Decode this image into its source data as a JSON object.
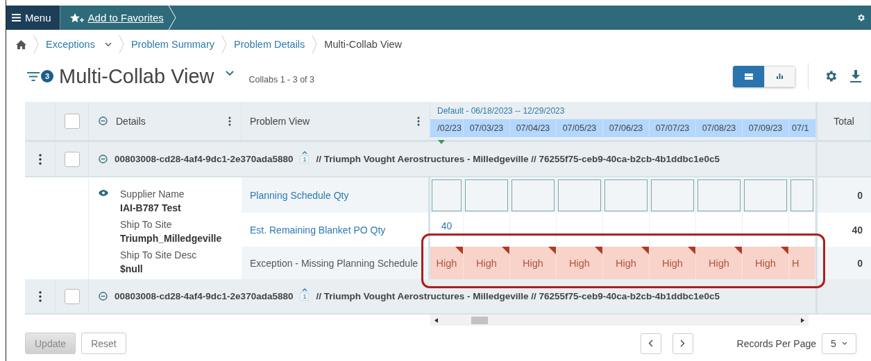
{
  "topbar": {
    "menu": "Menu",
    "favorites": "Add to Favorites"
  },
  "breadcrumbs": [
    {
      "label": "Exceptions",
      "dropdown": true
    },
    {
      "label": "Problem Summary",
      "dropdown": false
    },
    {
      "label": "Problem Details",
      "dropdown": false
    }
  ],
  "breadcrumb_current": "Multi-Collab View",
  "filter_count": "3",
  "title": "Multi-Collab View",
  "collabs": "Collabs 1 - 3 of 3",
  "views": [
    {
      "kind": "table",
      "selected": true
    },
    {
      "kind": "chart",
      "selected": false
    }
  ],
  "table": {
    "header_checked": false,
    "details_label": "Details",
    "problem_label": "Problem View",
    "range": "Default - 06/18/2023 -- 12/29/2023",
    "dates": [
      "/02/23",
      "07/03/23",
      "07/04/23",
      "07/05/23",
      "07/06/23",
      "07/07/23",
      "07/08/23",
      "07/09/23",
      "07/1"
    ],
    "total_label": "Total",
    "groups": [
      {
        "checked": false,
        "expanded": true,
        "id": "00803008-cd28-4af4-9dc1-2e370ada5880",
        "count": "1",
        "description": "// Triumph Vought Aerostructures - Milledgeville // 76255f75-ceb9-40ca-b2cb-4b1ddbc1e0c5",
        "details": [
          {
            "label": "Supplier Name",
            "value": "IAI-B787 Test"
          },
          {
            "label": "Ship To Site",
            "value": "Triumph_Milledgeville"
          },
          {
            "label": "Ship To Site Desc",
            "value": "$null"
          }
        ],
        "rows": [
          {
            "label": "Planning Schedule Qty",
            "link": true,
            "kind": "input",
            "total": "0"
          },
          {
            "label": "Est. Remaining Blanket PO Qty",
            "link": true,
            "kind": "value",
            "values": [
              "40"
            ],
            "total": "40"
          },
          {
            "label": "Exception - Missing Planning Schedule",
            "link": false,
            "kind": "severity",
            "values": [
              "High",
              "High",
              "High",
              "High",
              "High",
              "High",
              "High",
              "High",
              "H"
            ],
            "total": "0"
          }
        ]
      },
      {
        "checked": false,
        "expanded": true,
        "id": "00803008-cd28-4af4-9dc1-2e370ada5880",
        "count": "1",
        "description": "// Triumph Vought Aerostructures - Milledgeville // 76255f75-ceb9-40ca-b2cb-4b1ddbc1e0c5"
      }
    ]
  },
  "footer": {
    "update": {
      "label": "Update",
      "disabled": true
    },
    "reset": {
      "label": "Reset",
      "disabled": false
    },
    "records_label": "Records Per Page",
    "records_value": "5"
  }
}
